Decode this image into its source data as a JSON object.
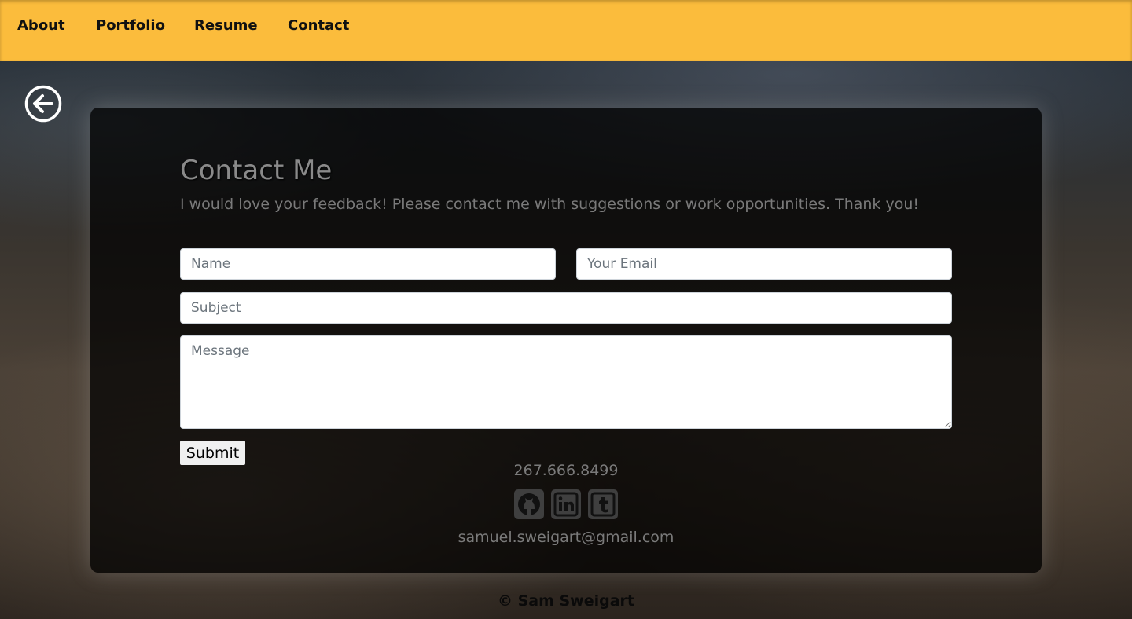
{
  "nav": {
    "items": [
      {
        "label": "About"
      },
      {
        "label": "Portfolio"
      },
      {
        "label": "Resume"
      },
      {
        "label": "Contact"
      }
    ]
  },
  "back_button": {
    "icon": "arrow-left-circle-icon"
  },
  "contact": {
    "title": "Contact Me",
    "subtitle": "I would love your feedback! Please contact me with suggestions or work opportunities. Thank you!",
    "form": {
      "name_placeholder": "Name",
      "email_placeholder": "Your Email",
      "subject_placeholder": "Subject",
      "message_placeholder": "Message",
      "name_value": "",
      "email_value": "",
      "subject_value": "",
      "message_value": "",
      "submit_label": "Submit"
    },
    "phone": "267.666.8499",
    "socials": [
      {
        "icon": "github-icon"
      },
      {
        "icon": "linkedin-icon"
      },
      {
        "icon": "tumblr-icon"
      }
    ],
    "email": "samuel.sweigart@gmail.com"
  },
  "footer": {
    "text": "© Sam Sweigart"
  },
  "colors": {
    "navbar": "#fbbc3c",
    "card": "rgba(0,0,0,0.72)",
    "muted_text": "#7a7a7a"
  }
}
